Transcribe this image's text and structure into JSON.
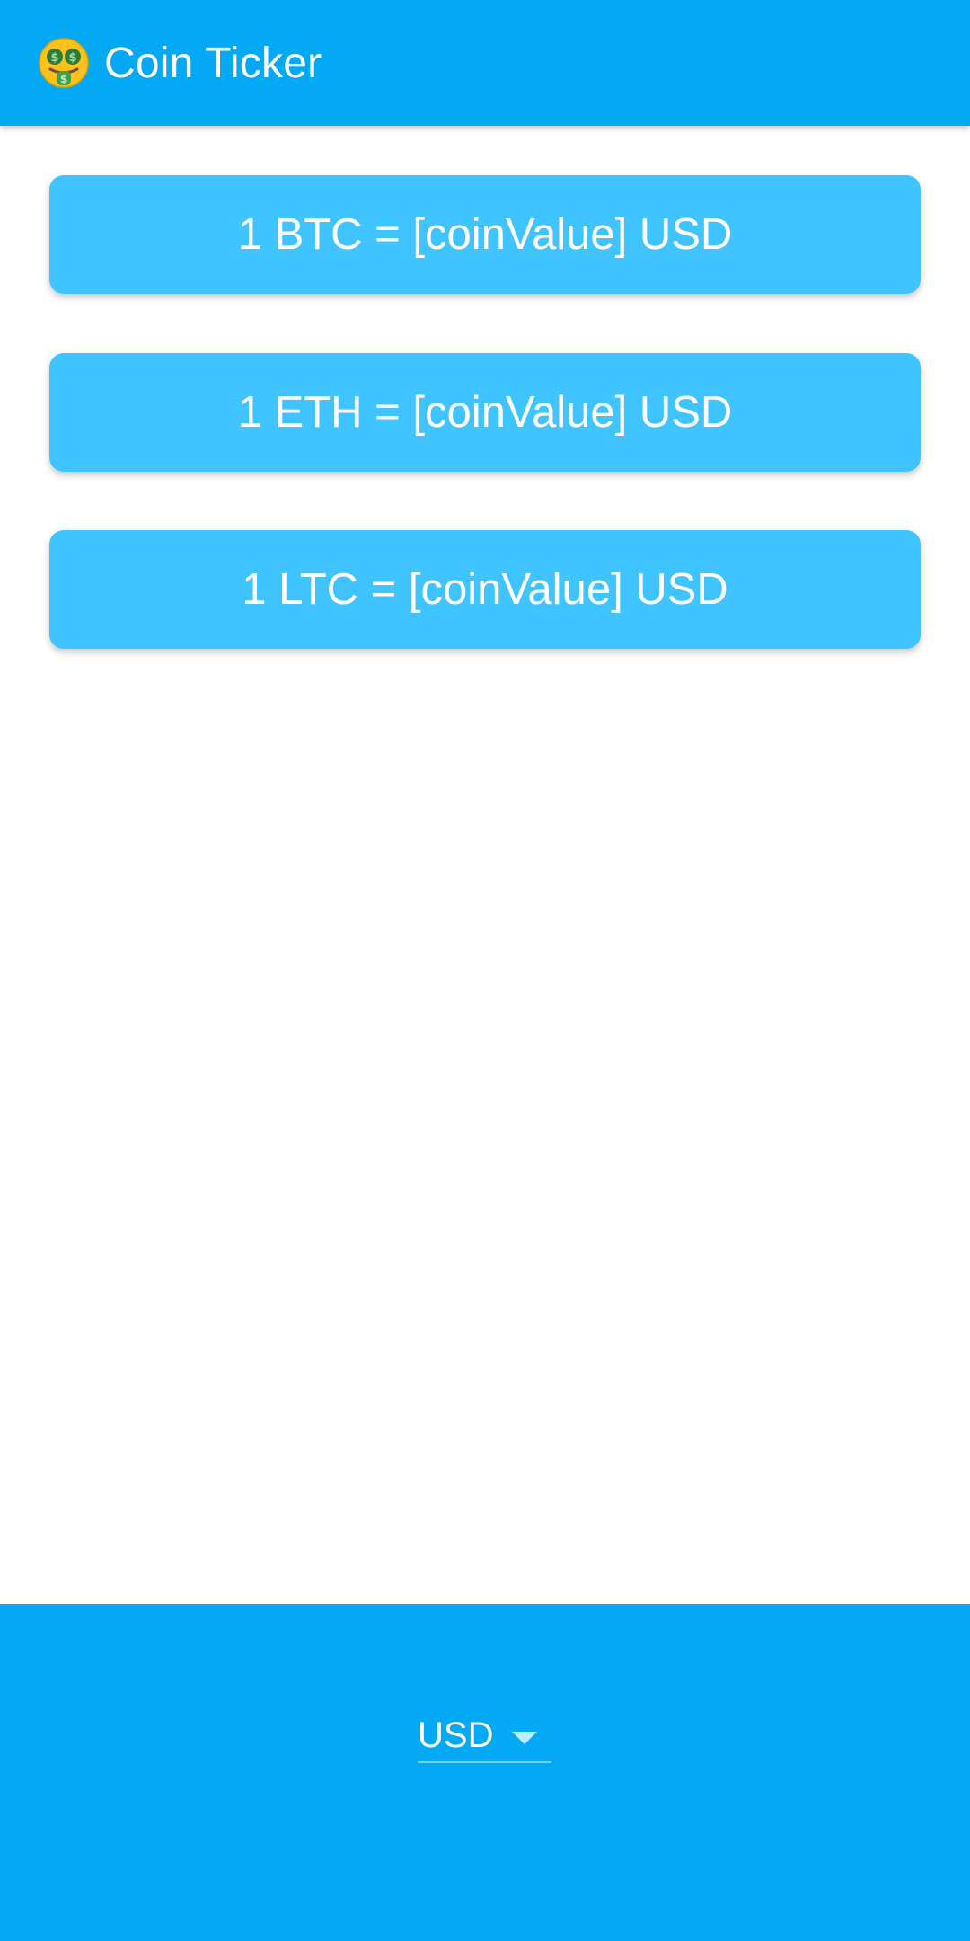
{
  "app_bar": {
    "icon": "money-mouth-face-icon",
    "title": "Coin Ticker",
    "color": "#03a9f4"
  },
  "coins": [
    {
      "label": "1 BTC = [coinValue] USD"
    },
    {
      "label": "1 ETH = [coinValue] USD"
    },
    {
      "label": "1 LTC = [coinValue] USD"
    }
  ],
  "card_color": "#40c4ff",
  "bottom_panel": {
    "selected_currency": "USD",
    "dropdown_icon": "caret-down-icon",
    "color": "#03a9f4"
  }
}
